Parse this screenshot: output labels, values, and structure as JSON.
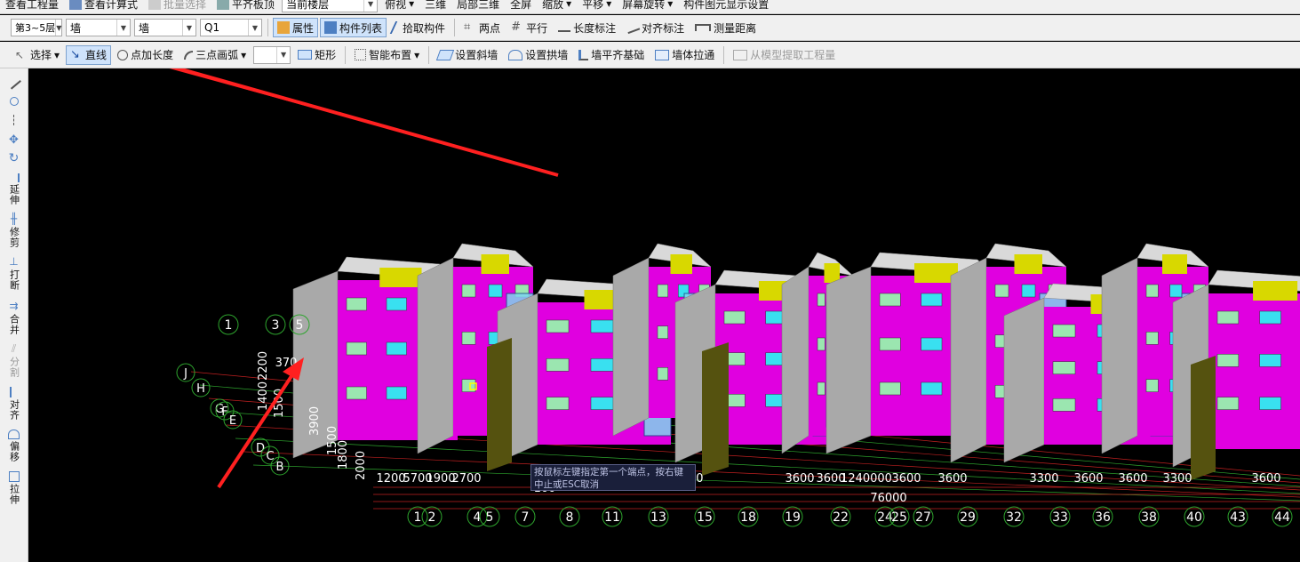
{
  "toolbar_top": {
    "items": [
      "查看工程量",
      "查看计算式",
      "批量选择",
      "平齐板顶",
      "当前楼层",
      "俯视",
      "三维",
      "局部三维",
      "全屏",
      "缩放",
      "平移",
      "屏幕旋转",
      "构件图元显示设置"
    ]
  },
  "toolbar_select": {
    "floor_range": "第3~5层",
    "category": "墙",
    "type": "墙",
    "component": "Q1",
    "buttons": [
      "属性",
      "构件列表",
      "拾取构件",
      "两点",
      "平行",
      "长度标注",
      "对齐标注",
      "测量距离"
    ]
  },
  "toolbar_draw": {
    "select_label": "选择",
    "buttons": [
      "直线",
      "点加长度",
      "三点画弧",
      "矩形",
      "智能布置",
      "设置斜墙",
      "设置拱墙",
      "墙平齐基础",
      "墙体拉通",
      "从模型提取工程量"
    ]
  },
  "left_toolbar": {
    "tools": [
      "延伸",
      "修剪",
      "打断",
      "合并",
      "分割",
      "对齐",
      "偏移",
      "拉伸"
    ]
  },
  "canvas": {
    "tooltip": "按鼠标左键指定第一个端点，按右键中止或ESC取消",
    "axis_cols": [
      "1",
      "2",
      "4",
      "5",
      "7",
      "8",
      "11",
      "13",
      "15",
      "18",
      "19",
      "22",
      "24",
      "25",
      "27",
      "29",
      "32",
      "33",
      "36",
      "38",
      "40",
      "43",
      "44"
    ],
    "axis_top_cols": [
      "1",
      "3",
      "5"
    ],
    "axis_rows": [
      "J",
      "H",
      "G",
      "F",
      "E",
      "D",
      "C",
      "B"
    ],
    "dims_bottom": [
      "1200",
      "5700",
      "1900",
      "2700",
      "20000",
      "3600",
      "3600",
      "3300",
      "3600",
      "3600",
      "1240000",
      "3600",
      "3600",
      "3300",
      "3600",
      "3600",
      "3300",
      "3600"
    ],
    "dim_100": "100",
    "dim_total": "76000",
    "dims_left": [
      "2200",
      "1400",
      "1500",
      "3900",
      "1500",
      "1800",
      "2000"
    ],
    "dim_370": "370"
  },
  "colors": {
    "accent": "#cfe3fb",
    "wall_magenta": "#e000e0",
    "wall_yellow": "#d8d800",
    "window_cyan": "#39e0f0",
    "arrow_red": "#ff2020",
    "axis_green": "#2ea52e"
  }
}
